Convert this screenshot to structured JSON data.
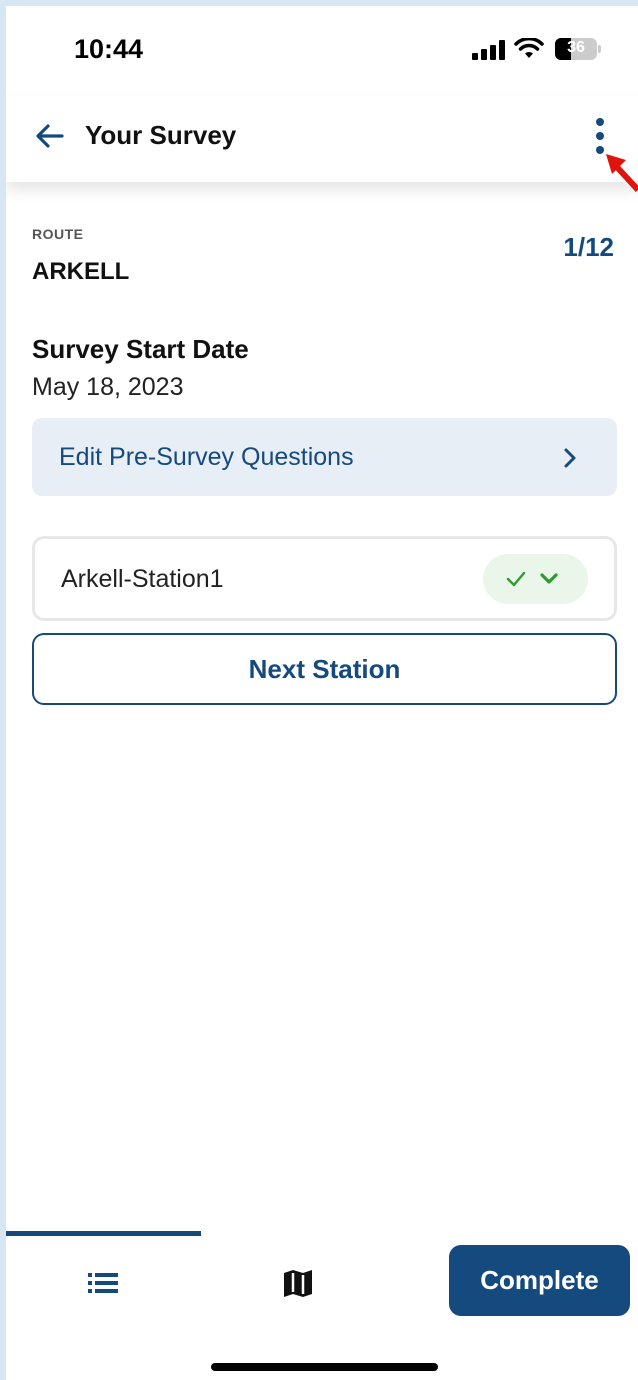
{
  "status_bar": {
    "time": "10:44",
    "battery": "36"
  },
  "header": {
    "title": "Your Survey"
  },
  "route": {
    "label": "ROUTE",
    "name": "ARKELL",
    "counter": "1/12"
  },
  "survey": {
    "start_date_label": "Survey Start Date",
    "start_date": "May 18, 2023",
    "pre_survey_label": "Edit Pre-Survey Questions"
  },
  "stations": [
    {
      "name": "Arkell-Station1",
      "status": "complete"
    }
  ],
  "actions": {
    "next_station": "Next Station",
    "complete": "Complete"
  },
  "colors": {
    "primary": "#144a7e",
    "success": "#2e9b2e",
    "pill_bg": "#eaf6ea",
    "row_bg": "#e8eef6"
  },
  "icons": {
    "back": "arrow-left-icon",
    "more": "more-vertical-icon",
    "chevron": "chevron-right-icon",
    "check": "check-icon",
    "expand": "chevron-down-icon",
    "list_tab": "list-icon",
    "map_tab": "map-icon"
  }
}
